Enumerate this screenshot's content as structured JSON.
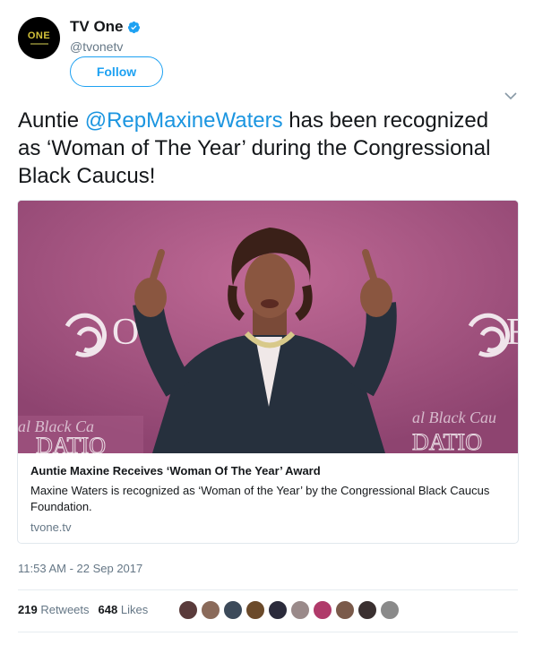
{
  "profile": {
    "avatar_text": "ONE",
    "name": "TV One",
    "handle": "@tvonetv",
    "follow_label": "Follow",
    "verified_color": "#1da1f2"
  },
  "tweet": {
    "text_before": "Auntie ",
    "mention": "@RepMaxineWaters",
    "text_after": " has been recognized as ‘Woman of The Year’ during the Congressional Black Caucus!"
  },
  "card": {
    "image_sign_left": "al Black Ca",
    "image_sign_left2": "DATIO",
    "image_sign_right": "al Black Cau",
    "image_sign_right2": "DATIO",
    "title": "Auntie Maxine Receives ‘Woman Of The Year’ Award",
    "description": "Maxine Waters is recognized as ‘Woman of the Year’ by the Congressional Black Caucus Foundation.",
    "domain": "tvone.tv"
  },
  "meta": {
    "timestamp": "11:53 AM - 22 Sep 2017",
    "retweets_count": "219",
    "retweets_label": "Retweets",
    "likes_count": "648",
    "likes_label": "Likes"
  },
  "likers": [
    "#5a3b3b",
    "#8a6a5a",
    "#3c4a5a",
    "#6b4a2a",
    "#2b2b3b",
    "#9a8a8a",
    "#b03a6a",
    "#7a5a4a",
    "#3a3030",
    "#8a8a8a"
  ],
  "colors": {
    "accent": "#1da1f2",
    "mention": "#1b95e0"
  }
}
